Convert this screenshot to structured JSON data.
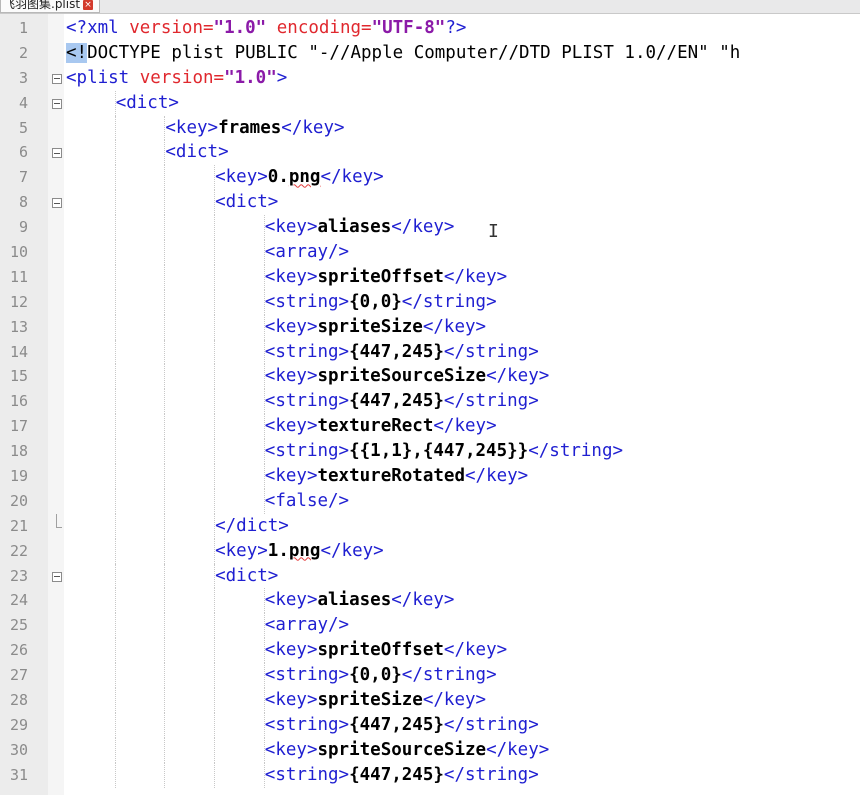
{
  "tab": {
    "title": "飞羽图集.plist",
    "close_icon": "close-icon"
  },
  "lines": [
    {
      "n": "1",
      "fold": "",
      "indent": 0,
      "spans": [
        [
          "t",
          "<?"
        ],
        [
          "t",
          "xml "
        ],
        [
          "a",
          "version="
        ],
        [
          "v",
          "\"1.0\""
        ],
        [
          "a",
          " encoding="
        ],
        [
          "v",
          "\"UTF-8\""
        ],
        [
          "t",
          "?>"
        ]
      ]
    },
    {
      "n": "2",
      "fold": "",
      "indent": 0,
      "spans": [
        [
          "sel",
          "<!"
        ],
        [
          "d",
          "DOCTYPE plist PUBLIC \"-//Apple Computer//DTD PLIST 1.0//EN\" \"h"
        ]
      ]
    },
    {
      "n": "3",
      "fold": "open",
      "indent": 0,
      "spans": [
        [
          "t",
          "<plist "
        ],
        [
          "a",
          "version="
        ],
        [
          "v",
          "\"1.0\""
        ],
        [
          "t",
          ">"
        ]
      ]
    },
    {
      "n": "4",
      "fold": "open",
      "indent": 1,
      "spans": [
        [
          "t",
          "<dict>"
        ]
      ]
    },
    {
      "n": "5",
      "fold": "",
      "indent": 2,
      "spans": [
        [
          "t",
          "<key>"
        ],
        [
          "b",
          "frames"
        ],
        [
          "t",
          "</key>"
        ]
      ]
    },
    {
      "n": "6",
      "fold": "open",
      "indent": 2,
      "spans": [
        [
          "t",
          "<dict>"
        ]
      ]
    },
    {
      "n": "7",
      "fold": "",
      "indent": 3,
      "spans": [
        [
          "t",
          "<key>"
        ],
        [
          "b",
          "0."
        ],
        [
          "bsq",
          "png"
        ],
        [
          "t",
          "</key>"
        ]
      ]
    },
    {
      "n": "8",
      "fold": "open",
      "indent": 3,
      "spans": [
        [
          "t",
          "<dict>"
        ]
      ]
    },
    {
      "n": "9",
      "fold": "",
      "indent": 4,
      "spans": [
        [
          "t",
          "<key>"
        ],
        [
          "b",
          "aliases"
        ],
        [
          "t",
          "</key>"
        ]
      ]
    },
    {
      "n": "10",
      "fold": "",
      "indent": 4,
      "spans": [
        [
          "t",
          "<array/>"
        ]
      ]
    },
    {
      "n": "11",
      "fold": "",
      "indent": 4,
      "spans": [
        [
          "t",
          "<key>"
        ],
        [
          "b",
          "spriteOffset"
        ],
        [
          "t",
          "</key>"
        ]
      ]
    },
    {
      "n": "12",
      "fold": "",
      "indent": 4,
      "spans": [
        [
          "t",
          "<string>"
        ],
        [
          "b",
          "{0,0}"
        ],
        [
          "t",
          "</string>"
        ]
      ]
    },
    {
      "n": "13",
      "fold": "",
      "indent": 4,
      "spans": [
        [
          "t",
          "<key>"
        ],
        [
          "b",
          "spriteSize"
        ],
        [
          "t",
          "</key>"
        ]
      ]
    },
    {
      "n": "14",
      "fold": "",
      "indent": 4,
      "spans": [
        [
          "t",
          "<string>"
        ],
        [
          "b",
          "{447,245}"
        ],
        [
          "t",
          "</string>"
        ]
      ]
    },
    {
      "n": "15",
      "fold": "",
      "indent": 4,
      "spans": [
        [
          "t",
          "<key>"
        ],
        [
          "b",
          "spriteSourceSize"
        ],
        [
          "t",
          "</key>"
        ]
      ]
    },
    {
      "n": "16",
      "fold": "",
      "indent": 4,
      "spans": [
        [
          "t",
          "<string>"
        ],
        [
          "b",
          "{447,245}"
        ],
        [
          "t",
          "</string>"
        ]
      ]
    },
    {
      "n": "17",
      "fold": "",
      "indent": 4,
      "spans": [
        [
          "t",
          "<key>"
        ],
        [
          "b",
          "textureRect"
        ],
        [
          "t",
          "</key>"
        ]
      ]
    },
    {
      "n": "18",
      "fold": "",
      "indent": 4,
      "spans": [
        [
          "t",
          "<string>"
        ],
        [
          "b",
          "{{1,1},{447,245}}"
        ],
        [
          "t",
          "</string>"
        ]
      ]
    },
    {
      "n": "19",
      "fold": "",
      "indent": 4,
      "spans": [
        [
          "t",
          "<key>"
        ],
        [
          "b",
          "textureRotated"
        ],
        [
          "t",
          "</key>"
        ]
      ]
    },
    {
      "n": "20",
      "fold": "",
      "indent": 4,
      "spans": [
        [
          "t",
          "<false/>"
        ]
      ]
    },
    {
      "n": "21",
      "fold": "end",
      "indent": 3,
      "spans": [
        [
          "t",
          "</dict>"
        ]
      ]
    },
    {
      "n": "22",
      "fold": "",
      "indent": 3,
      "spans": [
        [
          "t",
          "<key>"
        ],
        [
          "b",
          "1."
        ],
        [
          "bsq",
          "png"
        ],
        [
          "t",
          "</key>"
        ]
      ]
    },
    {
      "n": "23",
      "fold": "open",
      "indent": 3,
      "spans": [
        [
          "t",
          "<dict>"
        ]
      ]
    },
    {
      "n": "24",
      "fold": "",
      "indent": 4,
      "spans": [
        [
          "t",
          "<key>"
        ],
        [
          "b",
          "aliases"
        ],
        [
          "t",
          "</key>"
        ]
      ]
    },
    {
      "n": "25",
      "fold": "",
      "indent": 4,
      "spans": [
        [
          "t",
          "<array/>"
        ]
      ]
    },
    {
      "n": "26",
      "fold": "",
      "indent": 4,
      "spans": [
        [
          "t",
          "<key>"
        ],
        [
          "b",
          "spriteOffset"
        ],
        [
          "t",
          "</key>"
        ]
      ]
    },
    {
      "n": "27",
      "fold": "",
      "indent": 4,
      "spans": [
        [
          "t",
          "<string>"
        ],
        [
          "b",
          "{0,0}"
        ],
        [
          "t",
          "</string>"
        ]
      ]
    },
    {
      "n": "28",
      "fold": "",
      "indent": 4,
      "spans": [
        [
          "t",
          "<key>"
        ],
        [
          "b",
          "spriteSize"
        ],
        [
          "t",
          "</key>"
        ]
      ]
    },
    {
      "n": "29",
      "fold": "",
      "indent": 4,
      "spans": [
        [
          "t",
          "<string>"
        ],
        [
          "b",
          "{447,245}"
        ],
        [
          "t",
          "</string>"
        ]
      ]
    },
    {
      "n": "30",
      "fold": "",
      "indent": 4,
      "spans": [
        [
          "t",
          "<key>"
        ],
        [
          "b",
          "spriteSourceSize"
        ],
        [
          "t",
          "</key>"
        ]
      ]
    },
    {
      "n": "31",
      "fold": "",
      "indent": 4,
      "spans": [
        [
          "t",
          "<string>"
        ],
        [
          "b",
          "{447,245}"
        ],
        [
          "t",
          "</string>"
        ]
      ]
    }
  ],
  "colors": {
    "tag": "#1f1fd1",
    "attribute": "#e0282e",
    "attribute_value": "#8b1aa8",
    "text": "#000000",
    "line_number": "#8b8b8b",
    "selection": "#a8c8f0"
  },
  "cursor_icon": "text-cursor-icon"
}
